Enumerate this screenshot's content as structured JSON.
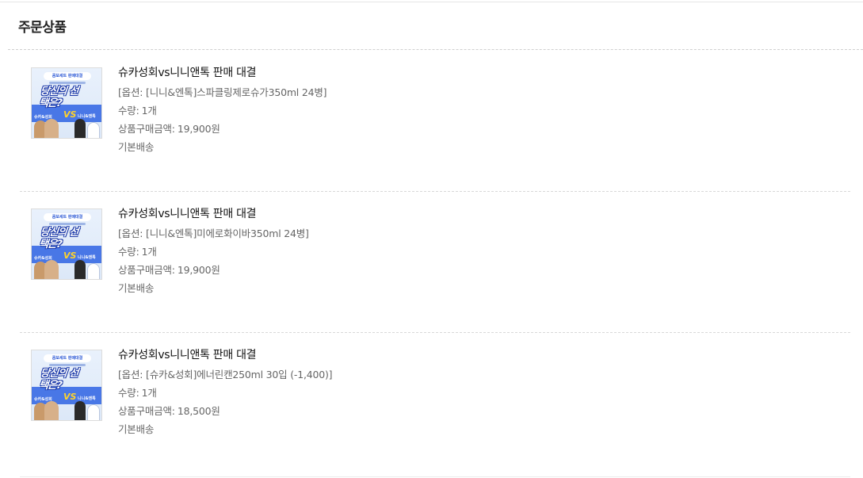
{
  "section": {
    "title": "주문상품"
  },
  "thumbnail": {
    "top_chip": "콤보세트 판매대결",
    "headline": "당신의 선택은?",
    "vs": "VS",
    "left_tag": "슈카&성회",
    "right_tag": "니니&앤톡"
  },
  "labels": {
    "quantity": "수량:",
    "price": "상품구매금액:"
  },
  "items": [
    {
      "name": "슈카성회vs니니앤톡 판매 대결",
      "option": "[옵션: [니니&엔톡]스파클링제로슈가350ml 24병]",
      "quantity": "1개",
      "price": "19,900원",
      "shipping": "기본배송"
    },
    {
      "name": "슈카성회vs니니앤톡 판매 대결",
      "option": "[옵션: [니니&엔톡]미에로화이바350ml 24병]",
      "quantity": "1개",
      "price": "19,900원",
      "shipping": "기본배송"
    },
    {
      "name": "슈카성회vs니니앤톡 판매 대결",
      "option": "[옵션: [슈카&성회]에너린캔250ml 30입 (-1,400)]",
      "quantity": "1개",
      "price": "18,500원",
      "shipping": "기본배송"
    }
  ]
}
